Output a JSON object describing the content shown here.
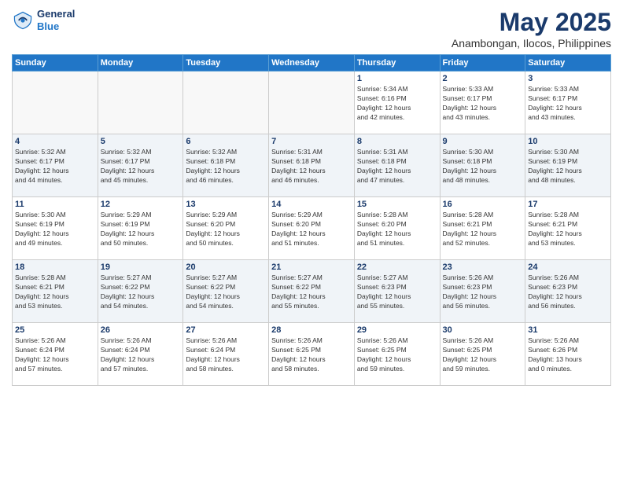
{
  "logo": {
    "line1": "General",
    "line2": "Blue"
  },
  "title": "May 2025",
  "location": "Anambongan, Ilocos, Philippines",
  "days_header": [
    "Sunday",
    "Monday",
    "Tuesday",
    "Wednesday",
    "Thursday",
    "Friday",
    "Saturday"
  ],
  "weeks": [
    [
      {
        "day": "",
        "info": ""
      },
      {
        "day": "",
        "info": ""
      },
      {
        "day": "",
        "info": ""
      },
      {
        "day": "",
        "info": ""
      },
      {
        "day": "1",
        "info": "Sunrise: 5:34 AM\nSunset: 6:16 PM\nDaylight: 12 hours\nand 42 minutes."
      },
      {
        "day": "2",
        "info": "Sunrise: 5:33 AM\nSunset: 6:17 PM\nDaylight: 12 hours\nand 43 minutes."
      },
      {
        "day": "3",
        "info": "Sunrise: 5:33 AM\nSunset: 6:17 PM\nDaylight: 12 hours\nand 43 minutes."
      }
    ],
    [
      {
        "day": "4",
        "info": "Sunrise: 5:32 AM\nSunset: 6:17 PM\nDaylight: 12 hours\nand 44 minutes."
      },
      {
        "day": "5",
        "info": "Sunrise: 5:32 AM\nSunset: 6:17 PM\nDaylight: 12 hours\nand 45 minutes."
      },
      {
        "day": "6",
        "info": "Sunrise: 5:32 AM\nSunset: 6:18 PM\nDaylight: 12 hours\nand 46 minutes."
      },
      {
        "day": "7",
        "info": "Sunrise: 5:31 AM\nSunset: 6:18 PM\nDaylight: 12 hours\nand 46 minutes."
      },
      {
        "day": "8",
        "info": "Sunrise: 5:31 AM\nSunset: 6:18 PM\nDaylight: 12 hours\nand 47 minutes."
      },
      {
        "day": "9",
        "info": "Sunrise: 5:30 AM\nSunset: 6:18 PM\nDaylight: 12 hours\nand 48 minutes."
      },
      {
        "day": "10",
        "info": "Sunrise: 5:30 AM\nSunset: 6:19 PM\nDaylight: 12 hours\nand 48 minutes."
      }
    ],
    [
      {
        "day": "11",
        "info": "Sunrise: 5:30 AM\nSunset: 6:19 PM\nDaylight: 12 hours\nand 49 minutes."
      },
      {
        "day": "12",
        "info": "Sunrise: 5:29 AM\nSunset: 6:19 PM\nDaylight: 12 hours\nand 50 minutes."
      },
      {
        "day": "13",
        "info": "Sunrise: 5:29 AM\nSunset: 6:20 PM\nDaylight: 12 hours\nand 50 minutes."
      },
      {
        "day": "14",
        "info": "Sunrise: 5:29 AM\nSunset: 6:20 PM\nDaylight: 12 hours\nand 51 minutes."
      },
      {
        "day": "15",
        "info": "Sunrise: 5:28 AM\nSunset: 6:20 PM\nDaylight: 12 hours\nand 51 minutes."
      },
      {
        "day": "16",
        "info": "Sunrise: 5:28 AM\nSunset: 6:21 PM\nDaylight: 12 hours\nand 52 minutes."
      },
      {
        "day": "17",
        "info": "Sunrise: 5:28 AM\nSunset: 6:21 PM\nDaylight: 12 hours\nand 53 minutes."
      }
    ],
    [
      {
        "day": "18",
        "info": "Sunrise: 5:28 AM\nSunset: 6:21 PM\nDaylight: 12 hours\nand 53 minutes."
      },
      {
        "day": "19",
        "info": "Sunrise: 5:27 AM\nSunset: 6:22 PM\nDaylight: 12 hours\nand 54 minutes."
      },
      {
        "day": "20",
        "info": "Sunrise: 5:27 AM\nSunset: 6:22 PM\nDaylight: 12 hours\nand 54 minutes."
      },
      {
        "day": "21",
        "info": "Sunrise: 5:27 AM\nSunset: 6:22 PM\nDaylight: 12 hours\nand 55 minutes."
      },
      {
        "day": "22",
        "info": "Sunrise: 5:27 AM\nSunset: 6:23 PM\nDaylight: 12 hours\nand 55 minutes."
      },
      {
        "day": "23",
        "info": "Sunrise: 5:26 AM\nSunset: 6:23 PM\nDaylight: 12 hours\nand 56 minutes."
      },
      {
        "day": "24",
        "info": "Sunrise: 5:26 AM\nSunset: 6:23 PM\nDaylight: 12 hours\nand 56 minutes."
      }
    ],
    [
      {
        "day": "25",
        "info": "Sunrise: 5:26 AM\nSunset: 6:24 PM\nDaylight: 12 hours\nand 57 minutes."
      },
      {
        "day": "26",
        "info": "Sunrise: 5:26 AM\nSunset: 6:24 PM\nDaylight: 12 hours\nand 57 minutes."
      },
      {
        "day": "27",
        "info": "Sunrise: 5:26 AM\nSunset: 6:24 PM\nDaylight: 12 hours\nand 58 minutes."
      },
      {
        "day": "28",
        "info": "Sunrise: 5:26 AM\nSunset: 6:25 PM\nDaylight: 12 hours\nand 58 minutes."
      },
      {
        "day": "29",
        "info": "Sunrise: 5:26 AM\nSunset: 6:25 PM\nDaylight: 12 hours\nand 59 minutes."
      },
      {
        "day": "30",
        "info": "Sunrise: 5:26 AM\nSunset: 6:25 PM\nDaylight: 12 hours\nand 59 minutes."
      },
      {
        "day": "31",
        "info": "Sunrise: 5:26 AM\nSunset: 6:26 PM\nDaylight: 13 hours\nand 0 minutes."
      }
    ]
  ]
}
